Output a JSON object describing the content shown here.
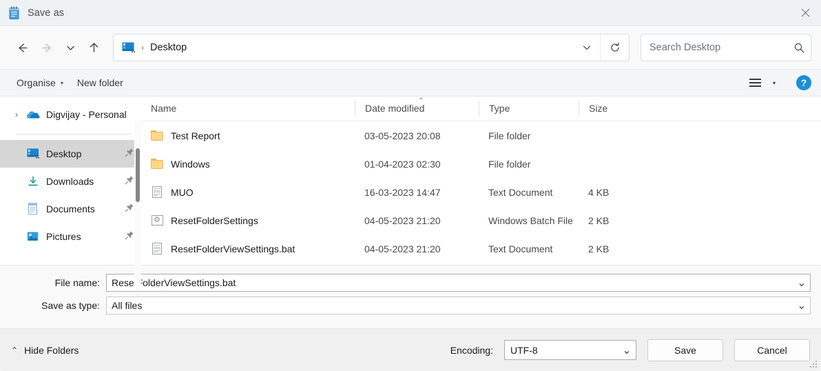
{
  "window": {
    "title": "Save as",
    "title_icon": "notepad-icon",
    "close_label": "✕"
  },
  "nav": {
    "back": "←",
    "forward": "→",
    "recent": "⌄",
    "up": "↑",
    "breadcrumb_icon": "desktop-icon",
    "breadcrumb_separator": "›",
    "breadcrumb_path": "Desktop",
    "dropdown": "⌄",
    "refresh": "↻"
  },
  "search": {
    "placeholder": "Search Desktop",
    "value": "",
    "icon": "search-icon"
  },
  "toolbar": {
    "organise_label": "Organise",
    "organise_caret": "▾",
    "new_folder_label": "New folder",
    "view_caret": "▾",
    "help_label": "?"
  },
  "sidebar": {
    "items": [
      {
        "label": "Digvijay - Personal",
        "icon": "onedrive-cloud-icon",
        "chevron": "›",
        "pinned": false,
        "selected": false
      },
      {
        "label": "Desktop",
        "icon": "desktop-icon",
        "chevron": "",
        "pinned": true,
        "selected": true
      },
      {
        "label": "Downloads",
        "icon": "downloads-icon",
        "chevron": "",
        "pinned": true,
        "selected": false
      },
      {
        "label": "Documents",
        "icon": "documents-icon",
        "chevron": "",
        "pinned": true,
        "selected": false
      },
      {
        "label": "Pictures",
        "icon": "pictures-icon",
        "chevron": "",
        "pinned": true,
        "selected": false
      }
    ],
    "pin_glyph": "📌"
  },
  "filelist": {
    "sort_indicator": "⌃",
    "columns": [
      "Name",
      "Date modified",
      "Type",
      "Size"
    ],
    "rows": [
      {
        "name": "Test Report",
        "date": "03-05-2023 20:08",
        "type": "File folder",
        "size": "",
        "icon": "folder-icon"
      },
      {
        "name": "Windows",
        "date": "01-04-2023 02:30",
        "type": "File folder",
        "size": "",
        "icon": "folder-icon"
      },
      {
        "name": "MUO",
        "date": "16-03-2023 14:47",
        "type": "Text Document",
        "size": "4 KB",
        "icon": "text-document-icon"
      },
      {
        "name": "ResetFolderSettings",
        "date": "04-05-2023 21:20",
        "type": "Windows Batch File",
        "size": "2 KB",
        "icon": "batch-file-icon"
      },
      {
        "name": "ResetFolderViewSettings.bat",
        "date": "04-05-2023 21:20",
        "type": "Text Document",
        "size": "2 KB",
        "icon": "text-document-icon"
      }
    ]
  },
  "form": {
    "filename_label": "File name:",
    "filename_value": "ResetFolderViewSettings.bat",
    "savetype_label": "Save as type:",
    "savetype_value": "All files",
    "chevron": "⌄"
  },
  "footer": {
    "hide_folders_label": "Hide Folders",
    "hide_folders_chevron": "⌃",
    "encoding_label": "Encoding:",
    "encoding_value": "UTF-8",
    "encoding_chevron": "⌄",
    "save_label": "Save",
    "cancel_label": "Cancel"
  },
  "colors": {
    "accent": "#1b8fd8",
    "folder": "#fcd888",
    "selection": "#d6d6d6",
    "titlebar": "#eef2f5"
  }
}
